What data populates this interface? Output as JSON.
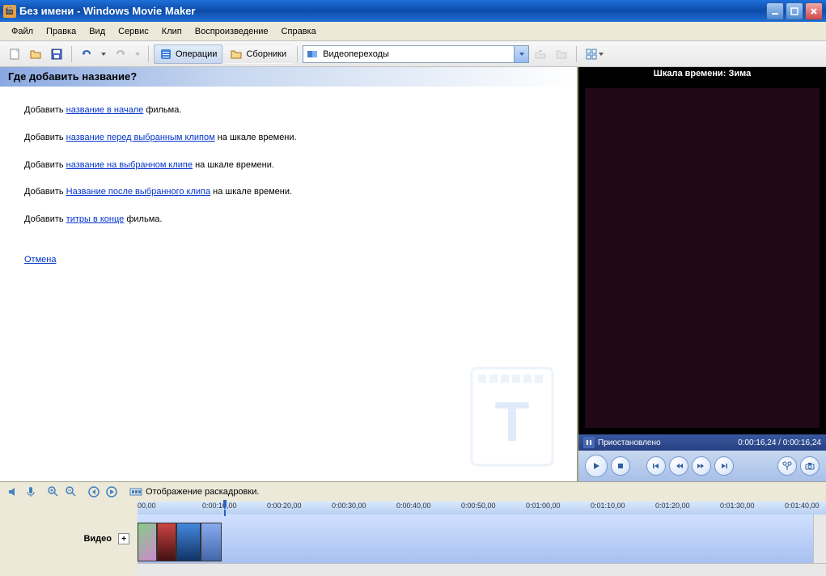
{
  "titlebar": {
    "title": "Без имени - Windows Movie Maker"
  },
  "menu": {
    "file": "Файл",
    "edit": "Правка",
    "view": "Вид",
    "service": "Сервис",
    "clip": "Клип",
    "play": "Воспроизведение",
    "help": "Справка"
  },
  "toolbar": {
    "operations": "Операции",
    "collections": "Сборники",
    "combo_value": "Видеопереходы"
  },
  "task": {
    "header": "Где добавить название?",
    "prefix": "Добавить ",
    "link1": "название в начале",
    "suffix1": " фильма.",
    "link2": "название перед выбранным клипом",
    "suffix2": " на шкале времени.",
    "link3": "название на выбранном клипе",
    "suffix3": " на шкале времени.",
    "link4": "Название после выбранного клипа",
    "suffix4": " на шкале времени.",
    "link5": "титры в конце",
    "suffix5": " фильма.",
    "cancel": "Отмена"
  },
  "preview": {
    "title": "Шкала времени: Зима",
    "status": "Приостановлено",
    "time": "0:00:16,24 / 0:00:16,24"
  },
  "timeline": {
    "storyboard_label": "Отображение раскадровки.",
    "video_label": "Видео",
    "ticks": [
      "00,00",
      "0:00:10,00",
      "0:00:20,00",
      "0:00:30,00",
      "0:00:40,00",
      "0:00:50,00",
      "0:01:00,00",
      "0:01:10,00",
      "0:01:20,00",
      "0:01:30,00",
      "0:01:40,00"
    ]
  }
}
